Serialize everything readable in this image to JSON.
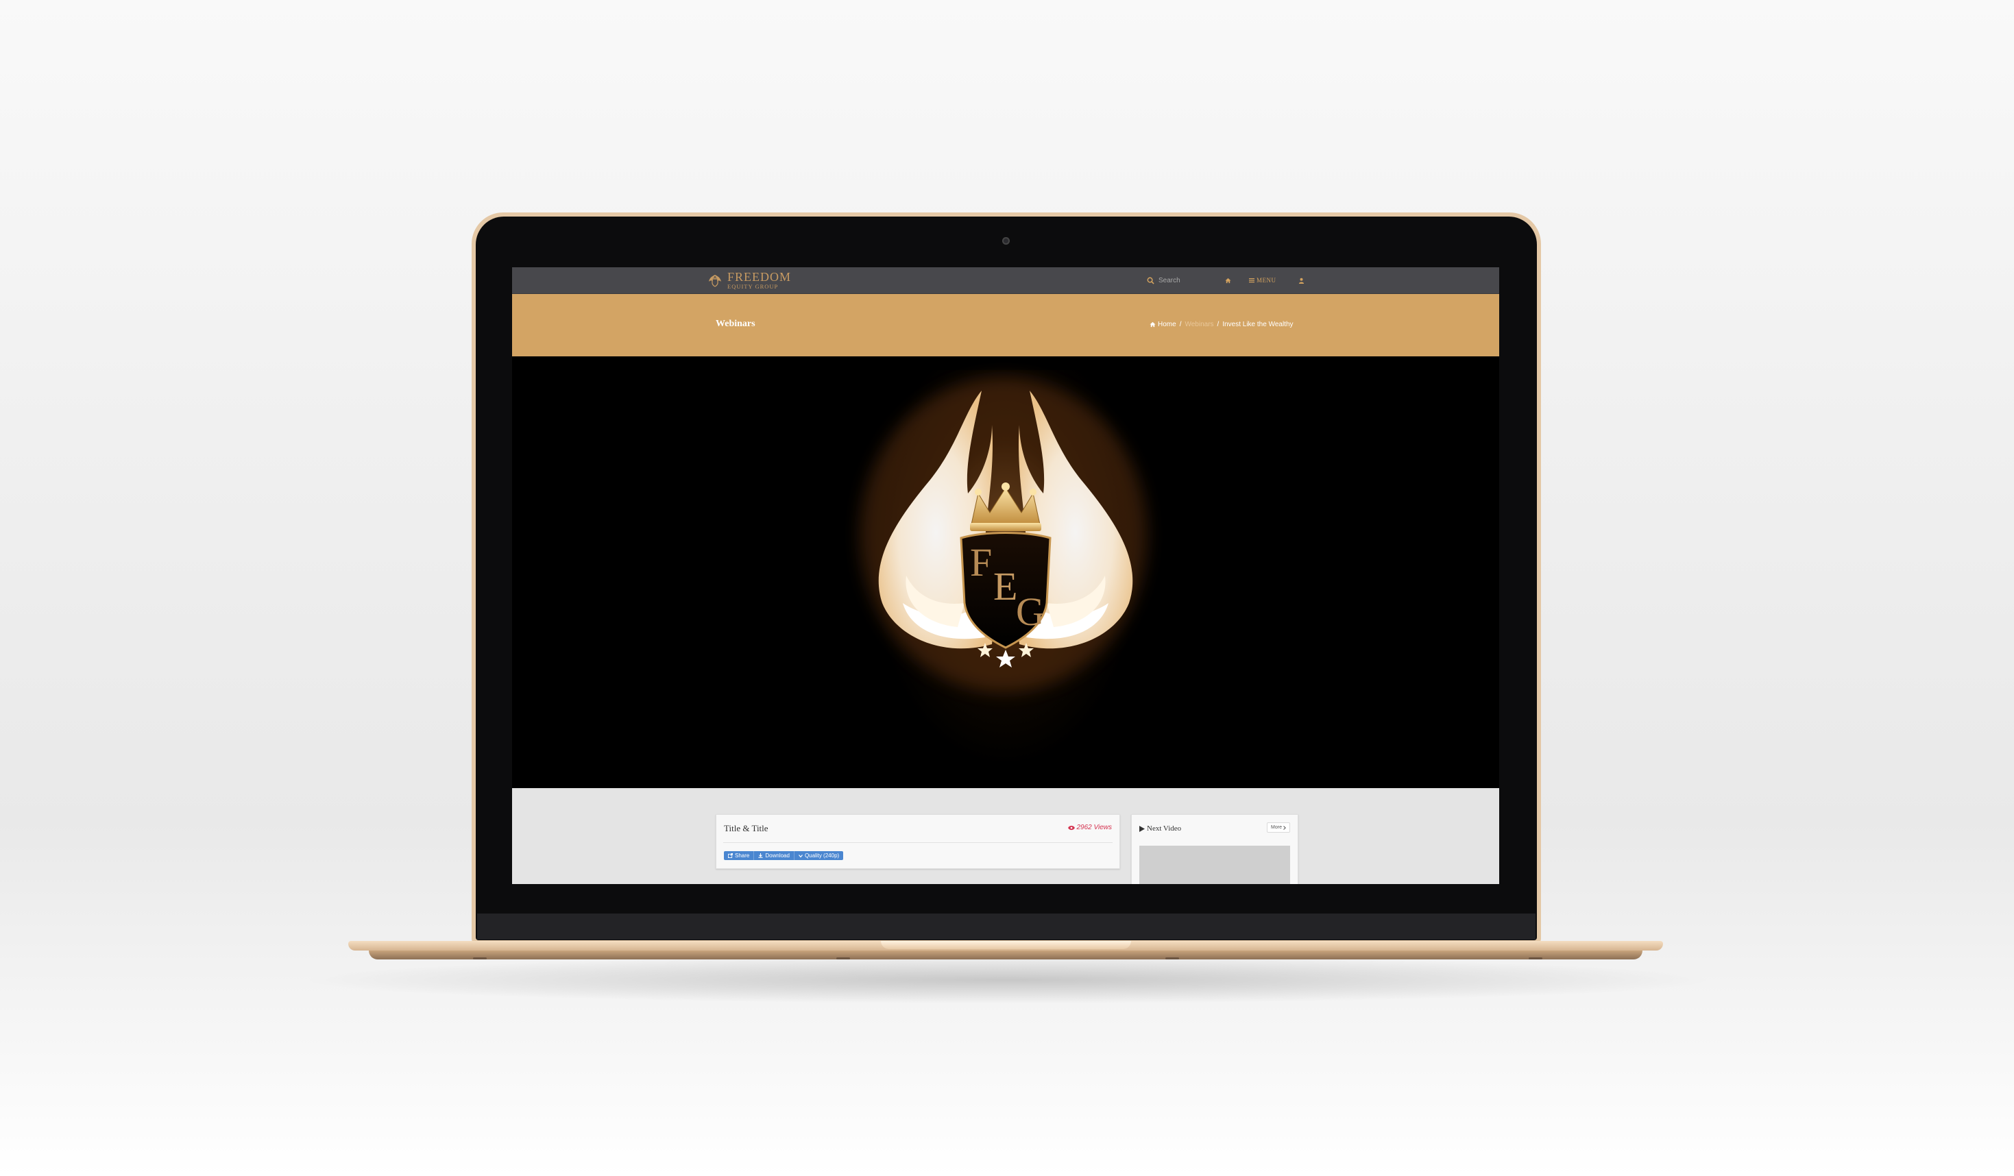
{
  "brand": {
    "logo_line1": "FREEDOM",
    "logo_line2": "EQUITY GROUP",
    "gold": "#d3a464",
    "nav_bg": "#48484c"
  },
  "navbar": {
    "search_placeholder": "Search",
    "home_icon": "home-icon",
    "menu_label": "MENU",
    "user_icon": "user-icon"
  },
  "banner": {
    "title": "Webinars",
    "breadcrumb": {
      "home": "Home",
      "middle": "Webinars",
      "current": "Invest Like the Wealthy"
    }
  },
  "video": {
    "emblem_letters": "FEG"
  },
  "video_info": {
    "title": "Title & Title",
    "views": "2962 Views",
    "buttons": {
      "share": "Share",
      "download": "Download",
      "quality": "Quality (240p)"
    }
  },
  "sidebar": {
    "next_video_title": "Next Video",
    "more_label": "More"
  }
}
